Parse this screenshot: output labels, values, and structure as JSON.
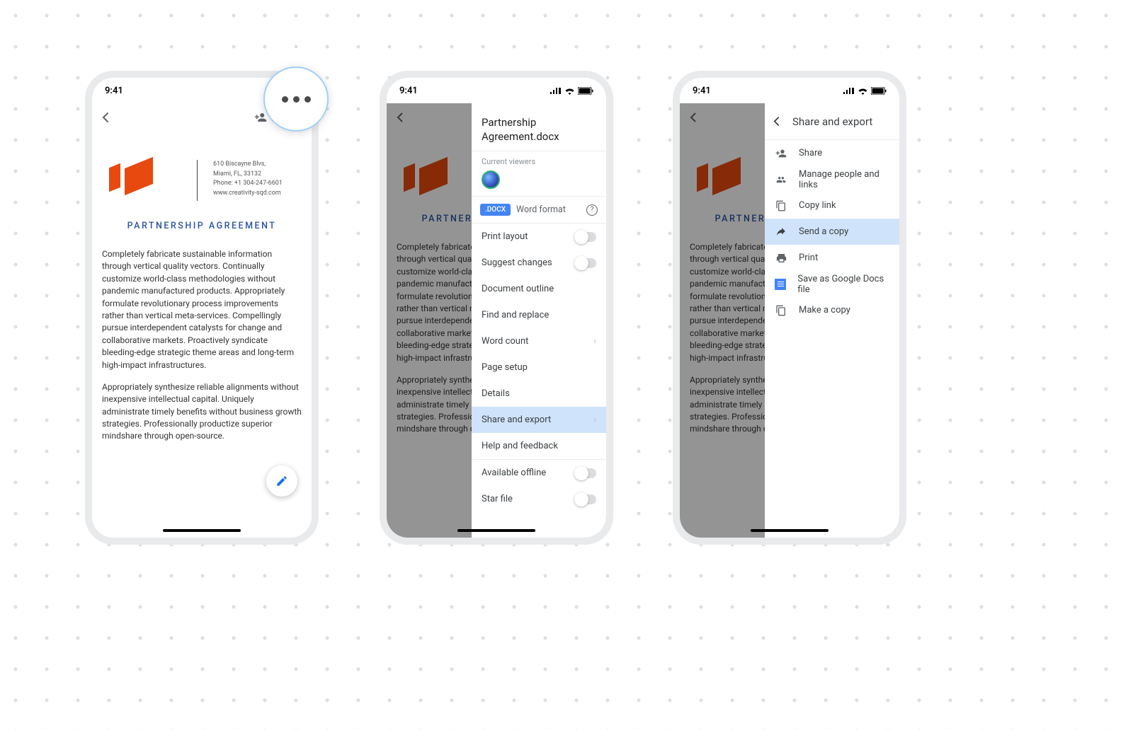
{
  "status": {
    "time": "9:41"
  },
  "doc": {
    "addr1": "610 Biscayne Blvs,",
    "addr2": "Miami, FL, 33132",
    "phone": "Phone: +1 304-247-6601",
    "web": "www.creativity-sqd.com",
    "title": "PARTNERSHIP AGREEMENT",
    "p1": "Completely fabricate sustainable information through vertical quality vectors. Continually customize world-class methodologies without pandemic manufactured products. Appropriately formulate revolutionary process improvements rather than vertical meta-services. Compellingly pursue interdependent catalysts for change and collaborative markets. Proactively syndicate bleeding-edge strategic theme areas and long-term high-impact infrastructures.",
    "p2": "Appropriately synthesize reliable alignments without inexpensive intellectual capital. Uniquely administrate timely benefits without business growth strategies. Professionally productize superior mindshare through open-source."
  },
  "panel1": {
    "file_name": "Partnership Agreement.docx",
    "current_viewers": "Current viewers",
    "badge": ".DOCX",
    "format": "Word format",
    "items": {
      "print_layout": "Print layout",
      "suggest": "Suggest changes",
      "outline": "Document outline",
      "find": "Find and replace",
      "wordcount": "Word count",
      "page_setup": "Page setup",
      "details": "Details",
      "share_export": "Share and export",
      "help": "Help and feedback",
      "offline": "Available offline",
      "star": "Star file"
    }
  },
  "panel2": {
    "title": "Share and export",
    "share": "Share",
    "manage": "Manage people and links",
    "copy": "Copy link",
    "send": "Send a copy",
    "print": "Print",
    "save": "Save as Google Docs file",
    "make": "Make a copy"
  }
}
